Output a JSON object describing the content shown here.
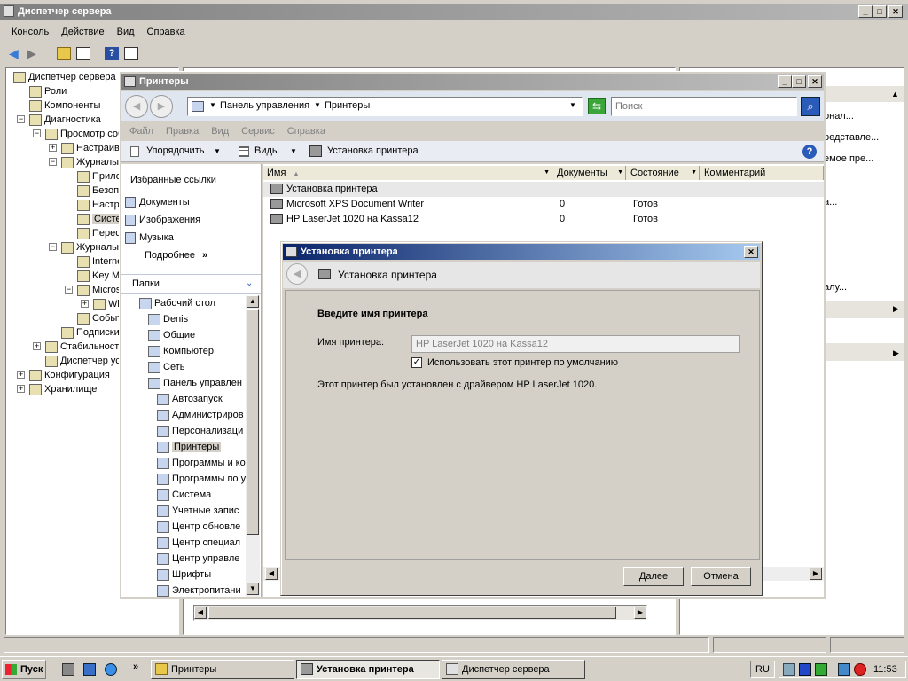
{
  "server_manager": {
    "title": "Диспетчер сервера",
    "menu": [
      "Консоль",
      "Действие",
      "Вид",
      "Справка"
    ],
    "tree": [
      {
        "label": "Диспетчер сервера (ME",
        "level": 0,
        "exp": ""
      },
      {
        "label": "Роли",
        "level": 1,
        "exp": ""
      },
      {
        "label": "Компоненты",
        "level": 1,
        "exp": ""
      },
      {
        "label": "Диагностика",
        "level": 1,
        "exp": "−"
      },
      {
        "label": "Просмотр событ",
        "level": 2,
        "exp": "−"
      },
      {
        "label": "Настраивае",
        "level": 3,
        "exp": "+"
      },
      {
        "label": "Журналы W",
        "level": 3,
        "exp": "−"
      },
      {
        "label": "Приложе",
        "level": 4,
        "exp": ""
      },
      {
        "label": "Безопас",
        "level": 4,
        "exp": ""
      },
      {
        "label": "Настрой",
        "level": 4,
        "exp": ""
      },
      {
        "label": "Система",
        "level": 4,
        "exp": "",
        "selected": true
      },
      {
        "label": "Пересла",
        "level": 4,
        "exp": ""
      },
      {
        "label": "Журналы пр",
        "level": 3,
        "exp": "−"
      },
      {
        "label": "Internet",
        "level": 4,
        "exp": ""
      },
      {
        "label": "Key Man",
        "level": 4,
        "exp": ""
      },
      {
        "label": "Microsoft",
        "level": 4,
        "exp": "−"
      },
      {
        "label": "Wind",
        "level": 5,
        "exp": "+"
      },
      {
        "label": "События",
        "level": 4,
        "exp": ""
      },
      {
        "label": "Подписки",
        "level": 3,
        "exp": ""
      },
      {
        "label": "Стабильность и",
        "level": 2,
        "exp": "+"
      },
      {
        "label": "Диспетчер устр",
        "level": 2,
        "exp": ""
      },
      {
        "label": "Конфигурация",
        "level": 1,
        "exp": "+"
      },
      {
        "label": "Хранилище",
        "level": 1,
        "exp": "+"
      }
    ],
    "actions": [
      "онал...",
      "редставле...",
      "емое пре...",
      "а...",
      "алу..."
    ]
  },
  "printers": {
    "title": "Принтеры",
    "breadcrumb": [
      "Панель управления",
      "Принтеры"
    ],
    "search_placeholder": "Поиск",
    "menu": [
      "Файл",
      "Правка",
      "Вид",
      "Сервис",
      "Справка"
    ],
    "toolbar": {
      "organize": "Упорядочить",
      "views": "Виды",
      "add_printer": "Установка принтера"
    },
    "fav_title": "Избранные ссылки",
    "favorites": [
      "Документы",
      "Изображения",
      "Музыка"
    ],
    "more": "Подробнее",
    "more_arrows": "»",
    "folders_title": "Папки",
    "folders": [
      {
        "label": "Рабочий стол",
        "level": 0
      },
      {
        "label": "Denis",
        "level": 1
      },
      {
        "label": "Общие",
        "level": 1
      },
      {
        "label": "Компьютер",
        "level": 1
      },
      {
        "label": "Сеть",
        "level": 1
      },
      {
        "label": "Панель управлен",
        "level": 1
      },
      {
        "label": "Автозапуск",
        "level": 2
      },
      {
        "label": "Администриров",
        "level": 2
      },
      {
        "label": "Персонализаци",
        "level": 2
      },
      {
        "label": "Принтеры",
        "level": 2,
        "selected": true
      },
      {
        "label": "Программы и ко",
        "level": 2
      },
      {
        "label": "Программы по у",
        "level": 2
      },
      {
        "label": "Система",
        "level": 2
      },
      {
        "label": "Учетные запис",
        "level": 2
      },
      {
        "label": "Центр обновле",
        "level": 2
      },
      {
        "label": "Центр специал",
        "level": 2
      },
      {
        "label": "Центр управле",
        "level": 2
      },
      {
        "label": "Шрифты",
        "level": 2
      },
      {
        "label": "Электропитани",
        "level": 2
      }
    ],
    "columns": [
      "Имя",
      "Документы",
      "Состояние",
      "Комментарий"
    ],
    "rows": [
      {
        "name": "Установка принтера",
        "docs": "",
        "state": "",
        "comment": ""
      },
      {
        "name": "Microsoft XPS Document Writer",
        "docs": "0",
        "state": "Готов",
        "comment": ""
      },
      {
        "name": "HP LaserJet 1020 на Kassa12",
        "docs": "0",
        "state": "Готов",
        "comment": ""
      }
    ]
  },
  "wizard": {
    "title": "Установка принтера",
    "header": "Установка принтера",
    "heading": "Введите имя принтера",
    "name_label": "Имя принтера:",
    "name_value": "HP LaserJet 1020 на Kassa12",
    "default_checkbox": "Использовать этот принтер по умолчанию",
    "default_checked": true,
    "info": "Этот принтер был установлен с драйвером HP LaserJet 1020.",
    "next": "Далее",
    "cancel": "Отмена"
  },
  "taskbar": {
    "start": "Пуск",
    "tasks": [
      "Принтеры",
      "Установка принтера",
      "Диспетчер сервера"
    ],
    "lang": "RU",
    "clock": "11:53",
    "quick_more": "»"
  },
  "colors": {
    "accent": "#0a246a",
    "title_inactive": "#808080",
    "selection": "#0a246a"
  }
}
